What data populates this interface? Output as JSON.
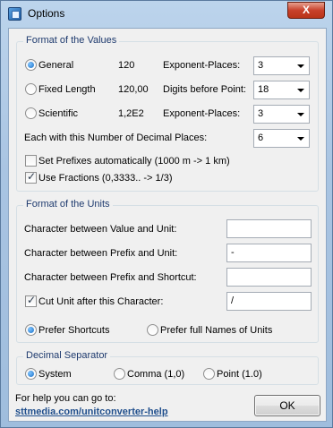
{
  "window": {
    "title": "Options",
    "close_label": "X"
  },
  "values_group": {
    "title": "Format of the Values",
    "rows": [
      {
        "radio_label": "General",
        "example": "120",
        "setting_label": "Exponent-Places:",
        "setting_value": "3",
        "selected": true
      },
      {
        "radio_label": "Fixed Length",
        "example": "120,00",
        "setting_label": "Digits before Point:",
        "setting_value": "18",
        "selected": false
      },
      {
        "radio_label": "Scientific",
        "example": "1,2E2",
        "setting_label": "Exponent-Places:",
        "setting_value": "3",
        "selected": false
      }
    ],
    "decimal_places_label": "Each with this Number of Decimal Places:",
    "decimal_places_value": "6",
    "set_prefixes_label": "Set Prefixes automatically (1000 m -> 1 km)",
    "set_prefixes_checked": false,
    "use_fractions_label": "Use Fractions (0,3333.. -> 1/3)",
    "use_fractions_checked": true
  },
  "units_group": {
    "title": "Format of the Units",
    "value_unit_label": "Character between Value and Unit:",
    "value_unit_value": "",
    "prefix_unit_label": "Character between Prefix and Unit:",
    "prefix_unit_value": "-",
    "prefix_shortcut_label": "Character between Prefix and Shortcut:",
    "prefix_shortcut_value": "",
    "cut_unit_label": "Cut Unit after this Character:",
    "cut_unit_checked": true,
    "cut_unit_value": "/",
    "prefer_shortcuts_label": "Prefer Shortcuts",
    "prefer_full_names_label": "Prefer full Names of Units",
    "prefer_shortcuts_selected": true
  },
  "separator_group": {
    "title": "Decimal Separator",
    "options": [
      "System",
      "Comma (1,0)",
      "Point (1.0)"
    ],
    "selected_index": 0
  },
  "footer": {
    "help_text": "For help you can go to:",
    "help_link": "sttmedia.com/unitconverter-help",
    "ok_label": "OK"
  },
  "colors": {
    "group_title": "#1e3a6e",
    "link": "#1f4e8c",
    "titlebar": "#a9c4e2",
    "close_button": "#c8412b"
  }
}
